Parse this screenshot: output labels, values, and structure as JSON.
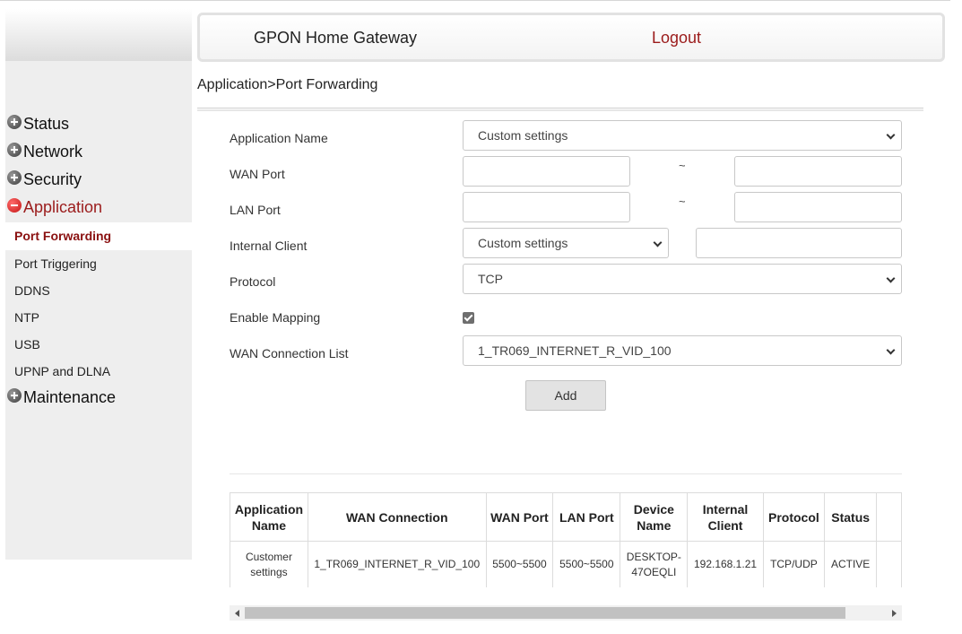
{
  "header": {
    "title": "GPON Home Gateway",
    "logout": "Logout"
  },
  "breadcrumb": "Application>Port Forwarding",
  "sidebar": {
    "groups": [
      {
        "label": "Status",
        "expanded": false
      },
      {
        "label": "Network",
        "expanded": false
      },
      {
        "label": "Security",
        "expanded": false
      },
      {
        "label": "Application",
        "expanded": true
      },
      {
        "label": "Maintenance",
        "expanded": false
      }
    ],
    "sub_items": [
      "Port Forwarding",
      "Port Triggering",
      "DDNS",
      "NTP",
      "USB",
      "UPNP and DLNA"
    ],
    "selected": "Port Forwarding"
  },
  "form": {
    "app_name_label": "Application Name",
    "app_name_value": "Custom settings",
    "wan_port_label": "WAN Port",
    "lan_port_label": "LAN Port",
    "range_sep": "~",
    "internal_client_label": "Internal Client",
    "internal_client_value": "Custom settings",
    "protocol_label": "Protocol",
    "protocol_value": "TCP",
    "enable_mapping_label": "Enable Mapping",
    "enable_mapping_checked": true,
    "wan_conn_label": "WAN Connection List",
    "wan_conn_value": "1_TR069_INTERNET_R_VID_100",
    "add_label": "Add"
  },
  "table": {
    "headers": [
      "Application Name",
      "WAN Connection",
      "WAN Port",
      "LAN Port",
      "Device Name",
      "Internal Client",
      "Protocol",
      "Status"
    ],
    "rows": [
      [
        "Customer settings",
        "1_TR069_INTERNET_R_VID_100",
        "5500~5500",
        "5500~5500",
        "DESKTOP-47OEQLI",
        "192.168.1.21",
        "TCP/UDP",
        "ACTIVE"
      ]
    ]
  },
  "colors": {
    "accent": "#9b1b1b",
    "sidebar_bg": "#eeeeee"
  }
}
